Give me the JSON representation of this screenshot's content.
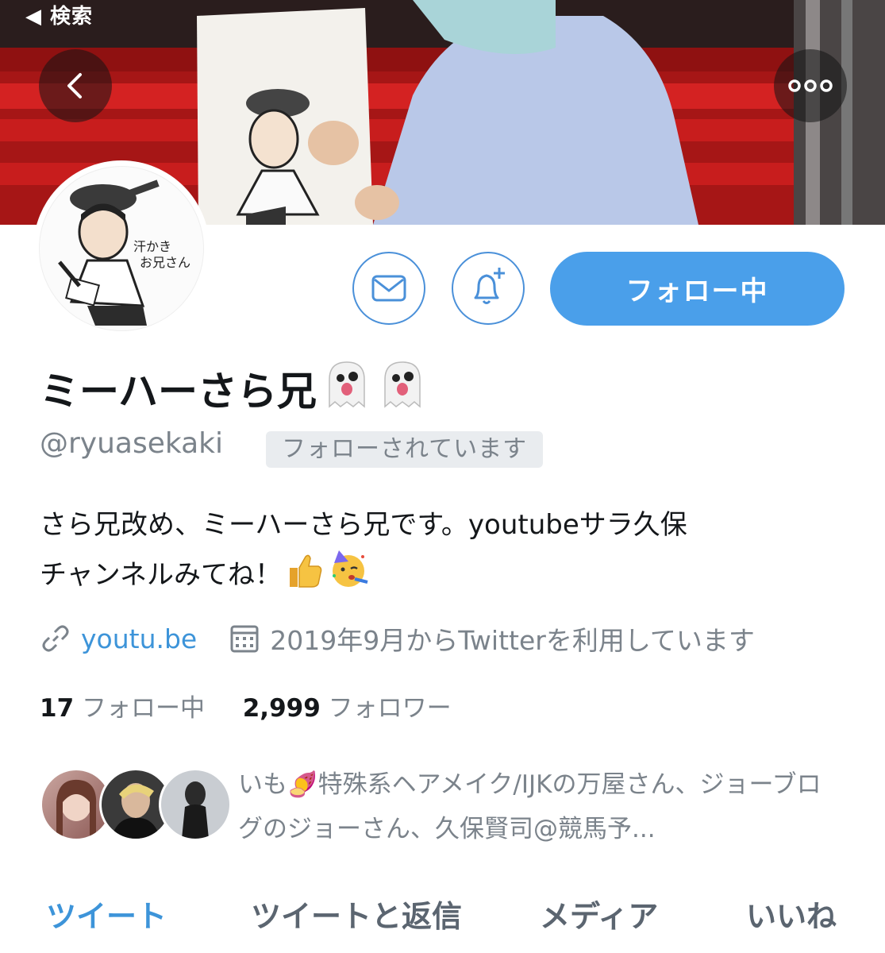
{
  "status_bar": {
    "back_label": "◀ 検索"
  },
  "profile": {
    "display_name": "ミーハーさら兄",
    "handle": "@ryuasekaki",
    "follows_you": "フォローされています",
    "bio_line1": "さら兄改め、ミーハーさら兄です。youtubeサラ久保",
    "bio_line2": "チャンネルみてね！",
    "link": "youtu.be",
    "joined": "2019年9月からTwitterを利用しています",
    "following_count": "17",
    "following_label": "フォロー中",
    "followers_count": "2,999",
    "followers_label": "フォロワー",
    "known_followers_text": "いも🍠特殊系ヘアメイク/IJKの万屋さん、ジョーブログのジョーさん、久保賢司@競馬予..."
  },
  "actions": {
    "follow_button": "フォロー中"
  },
  "tabs": [
    "ツイート",
    "ツイートと返信",
    "メディア",
    "いいね"
  ],
  "colors": {
    "accent": "#4a9fea",
    "link": "#3d94d9",
    "muted": "#7b838b"
  },
  "icons": [
    "back-icon",
    "more-icon",
    "mail-icon",
    "bell-plus-icon",
    "link-icon",
    "calendar-icon",
    "ghost-emoji",
    "thumbs-up-emoji",
    "party-face-emoji"
  ]
}
